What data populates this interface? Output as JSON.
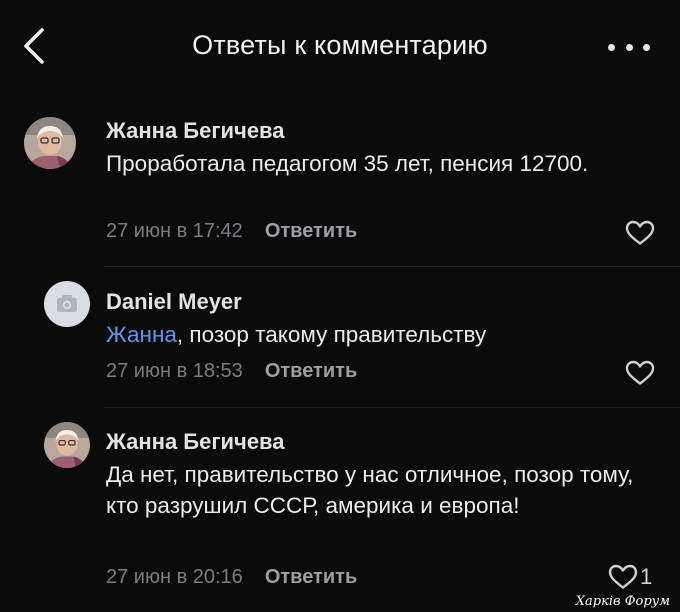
{
  "header": {
    "title": "Ответы к комментарию",
    "back_icon": "chevron-left-icon",
    "more_icon": "more-dots-icon"
  },
  "comments": [
    {
      "author": "Жанна Бегичева",
      "mention": "",
      "text": "Проработала педагогом 35 лет, пенсия 12700.",
      "time": "27 июн в 17:42",
      "reply_label": "Ответить",
      "like_count": "",
      "avatar": "user-photo-avatar"
    },
    {
      "author": "Daniel Meyer",
      "mention": "Жанна",
      "text": ", позор такому правительству",
      "time": "27 июн в 18:53",
      "reply_label": "Ответить",
      "like_count": "",
      "avatar": "camera-placeholder-avatar"
    },
    {
      "author": "Жанна Бегичева",
      "mention": "",
      "text": "Да нет, правительство у нас отличное, позор тому, кто разрушил СССР, америка и европа!",
      "time": "27 июн в 20:16",
      "reply_label": "Ответить",
      "like_count": "1",
      "avatar": "user-photo-avatar"
    }
  ],
  "watermark": "Харків Форум",
  "colors": {
    "background": "#0b0b0c",
    "mention": "#5d9be8",
    "meta_text": "#7c7c82"
  }
}
